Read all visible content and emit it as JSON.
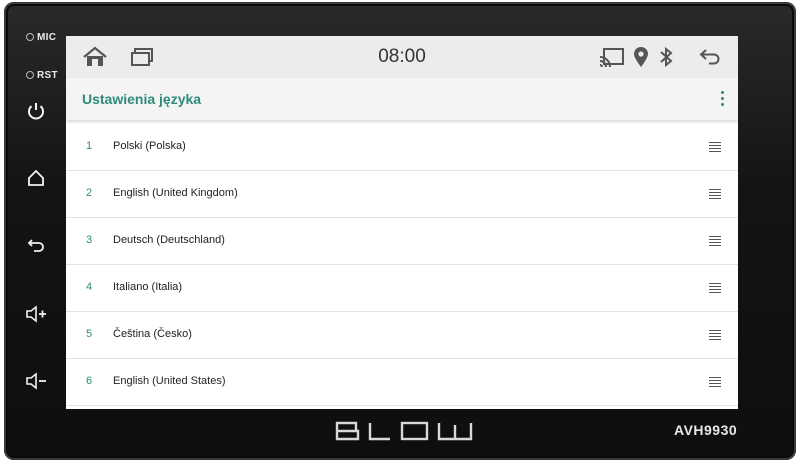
{
  "device": {
    "mic_label": "MIC",
    "rst_label": "RST",
    "brand": "BLOW",
    "model": "AVH9930"
  },
  "statusbar": {
    "time": "08:00"
  },
  "appbar": {
    "title": "Ustawienia języka"
  },
  "languages": [
    {
      "num": "1",
      "label": "Polski (Polska)"
    },
    {
      "num": "2",
      "label": "English (United Kingdom)"
    },
    {
      "num": "3",
      "label": "Deutsch (Deutschland)"
    },
    {
      "num": "4",
      "label": "Italiano (Italia)"
    },
    {
      "num": "5",
      "label": "Čeština (Česko)"
    },
    {
      "num": "6",
      "label": "English (United States)"
    }
  ],
  "colors": {
    "accent": "#2e8b7a",
    "bezel": "#141414",
    "statusbar": "#ececec"
  }
}
